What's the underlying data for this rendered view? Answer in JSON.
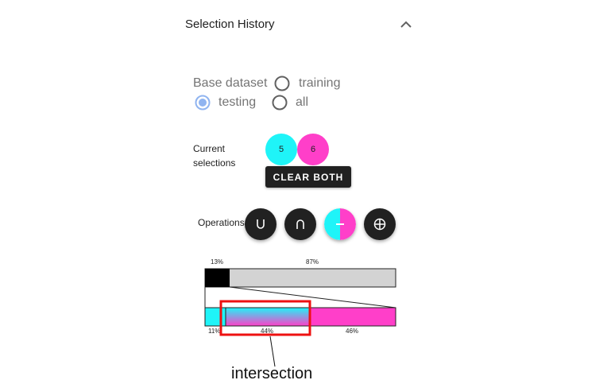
{
  "panel": {
    "title": "Selection History"
  },
  "base_dataset": {
    "label": "Base dataset",
    "options": [
      {
        "label": "training",
        "selected": false
      },
      {
        "label": "testing",
        "selected": true
      },
      {
        "label": "all",
        "selected": false
      }
    ]
  },
  "current_selections": {
    "label_line1": "Current",
    "label_line2": "selections",
    "items": [
      {
        "label": "5",
        "color": "#1ff4f8"
      },
      {
        "label": "6",
        "color": "#ff3fc9"
      }
    ],
    "clear_label": "CLEAR BOTH"
  },
  "operations": {
    "label": "Operations",
    "buttons": [
      "union",
      "intersection",
      "difference",
      "symmetric-difference"
    ]
  },
  "proportion_bars": {
    "top": {
      "selected_pct": "13%",
      "rest_pct": "87%",
      "selected_fraction": 0.13
    },
    "bottom": {
      "left_pct": "11%",
      "middle_pct": "44%",
      "right_pct": "46%",
      "left_fraction": 0.11,
      "middle_fraction": 0.44,
      "right_fraction": 0.46
    }
  },
  "annotation": {
    "text": "intersection"
  },
  "colors": {
    "cyan": "#1ff4f8",
    "magenta": "#ff3fc9",
    "dark": "#212121",
    "highlight": "#e11"
  }
}
